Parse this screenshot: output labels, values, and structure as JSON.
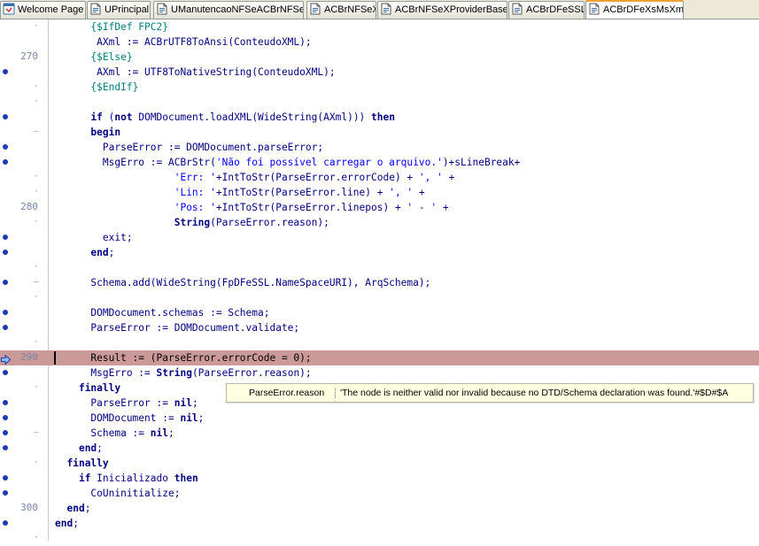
{
  "tabs": [
    {
      "label": "Welcome Page",
      "icon": "welcome-page-icon",
      "active": false
    },
    {
      "label": "UPrincipal",
      "icon": "unit-file-icon",
      "active": false
    },
    {
      "label": "UManutencaoNFSeACBrNFSeX",
      "icon": "unit-file-icon",
      "active": false
    },
    {
      "label": "ACBrNFSeX",
      "icon": "unit-file-icon",
      "active": false
    },
    {
      "label": "ACBrNFSeXProviderBase",
      "icon": "unit-file-icon",
      "active": false
    },
    {
      "label": "ACBrDFeSSL",
      "icon": "unit-file-icon",
      "active": false
    },
    {
      "label": "ACBrDFeXsMsXml",
      "icon": "unit-file-icon",
      "active": true
    }
  ],
  "editor": {
    "line_numbers": [
      "270",
      "280",
      "290",
      "300"
    ],
    "lines": [
      {
        "tokens": [
          [
            "      ",
            "p"
          ],
          [
            "{$IfDef FPC2}",
            "d"
          ]
        ],
        "gutter": "tick"
      },
      {
        "tokens": [
          [
            "       AXml := ACBrUTF8ToAnsi(ConteudoXML);",
            "p"
          ]
        ],
        "gutter": "none"
      },
      {
        "tokens": [
          [
            "      ",
            "p"
          ],
          [
            "{$Else}",
            "d"
          ]
        ],
        "gutter": "num",
        "num": 0
      },
      {
        "tokens": [
          [
            "       AXml := UTF8ToNativeString(ConteudoXML);",
            "p"
          ]
        ],
        "gutter": "dot"
      },
      {
        "tokens": [
          [
            "      ",
            "p"
          ],
          [
            "{$EndIf}",
            "d"
          ]
        ],
        "gutter": "tick"
      },
      {
        "tokens": [],
        "gutter": "tick"
      },
      {
        "tokens": [
          [
            "      ",
            "p"
          ],
          [
            "if",
            "k"
          ],
          [
            " (",
            "p"
          ],
          [
            "not",
            "k"
          ],
          [
            " DOMDocument.loadXML(WideString(AXml))) ",
            "p"
          ],
          [
            "then",
            "k"
          ]
        ],
        "gutter": "dot"
      },
      {
        "tokens": [
          [
            "      ",
            "p"
          ],
          [
            "begin",
            "k"
          ]
        ],
        "gutter": "dash"
      },
      {
        "tokens": [
          [
            "        ParseError := DOMDocument.parseError;",
            "p"
          ]
        ],
        "gutter": "dot"
      },
      {
        "tokens": [
          [
            "        MsgErro := ACBrStr(",
            "p"
          ],
          [
            "'Não foi possível carregar o arquivo.'",
            "s"
          ],
          [
            ")+sLineBreak+",
            "p"
          ]
        ],
        "gutter": "dot"
      },
      {
        "tokens": [
          [
            "                    ",
            "p"
          ],
          [
            "'Err: '",
            "s"
          ],
          [
            "+IntToStr(ParseError.errorCode) + ",
            "p"
          ],
          [
            "', '",
            "s"
          ],
          [
            " +",
            "p"
          ]
        ],
        "gutter": "tick"
      },
      {
        "tokens": [
          [
            "                    ",
            "p"
          ],
          [
            "'Lin: '",
            "s"
          ],
          [
            "+IntToStr(ParseError.line) + ",
            "p"
          ],
          [
            "', '",
            "s"
          ],
          [
            " +",
            "p"
          ]
        ],
        "gutter": "tick"
      },
      {
        "tokens": [
          [
            "                    ",
            "p"
          ],
          [
            "'Pos: '",
            "s"
          ],
          [
            "+IntToStr(ParseError.linepos) + ",
            "p"
          ],
          [
            "' - '",
            "s"
          ],
          [
            " +",
            "p"
          ]
        ],
        "gutter": "num",
        "num": 1
      },
      {
        "tokens": [
          [
            "                    ",
            "p"
          ],
          [
            "String",
            "k"
          ],
          [
            "(ParseError.reason);",
            "p"
          ]
        ],
        "gutter": "tick"
      },
      {
        "tokens": [
          [
            "        exit;",
            "p"
          ]
        ],
        "gutter": "dot"
      },
      {
        "tokens": [
          [
            "      ",
            "p"
          ],
          [
            "end",
            "k"
          ],
          [
            ";",
            "p"
          ]
        ],
        "gutter": "dot"
      },
      {
        "tokens": [],
        "gutter": "tick"
      },
      {
        "tokens": [
          [
            "      Schema.add(WideString(FpDFeSSL.NameSpaceURI), ArqSchema);",
            "p"
          ]
        ],
        "gutter": "dot-dash"
      },
      {
        "tokens": [],
        "gutter": "tick"
      },
      {
        "tokens": [
          [
            "      DOMDocument.schemas := Schema;",
            "p"
          ]
        ],
        "gutter": "dot"
      },
      {
        "tokens": [
          [
            "      ParseError := DOMDocument.validate;",
            "p"
          ]
        ],
        "gutter": "dot"
      },
      {
        "tokens": [],
        "gutter": "tick"
      },
      {
        "tokens": [
          [
            "      Result := (ParseError.errorCode = 0);",
            "p"
          ]
        ],
        "gutter": "arrow-num",
        "num": 2,
        "exec": true
      },
      {
        "tokens": [
          [
            "      MsgErro := ",
            "p"
          ],
          [
            "String",
            "k"
          ],
          [
            "(ParseError.reason);",
            "p"
          ]
        ],
        "gutter": "dot"
      },
      {
        "tokens": [
          [
            "    ",
            "p"
          ],
          [
            "finally",
            "k"
          ]
        ],
        "gutter": "tick"
      },
      {
        "tokens": [
          [
            "      ParseError := ",
            "p"
          ],
          [
            "nil",
            "k"
          ],
          [
            ";",
            "p"
          ]
        ],
        "gutter": "dot"
      },
      {
        "tokens": [
          [
            "      DOMDocument := ",
            "p"
          ],
          [
            "nil",
            "k"
          ],
          [
            ";",
            "p"
          ]
        ],
        "gutter": "dot"
      },
      {
        "tokens": [
          [
            "      Schema := ",
            "p"
          ],
          [
            "nil",
            "k"
          ],
          [
            ";",
            "p"
          ]
        ],
        "gutter": "dot-dash"
      },
      {
        "tokens": [
          [
            "    ",
            "p"
          ],
          [
            "end",
            "k"
          ],
          [
            ";",
            "p"
          ]
        ],
        "gutter": "dot"
      },
      {
        "tokens": [
          [
            "  ",
            "p"
          ],
          [
            "finally",
            "k"
          ]
        ],
        "gutter": "tick"
      },
      {
        "tokens": [
          [
            "    ",
            "p"
          ],
          [
            "if",
            "k"
          ],
          [
            " Inicializado ",
            "p"
          ],
          [
            "then",
            "k"
          ]
        ],
        "gutter": "dot"
      },
      {
        "tokens": [
          [
            "      CoUninitialize;",
            "p"
          ]
        ],
        "gutter": "dot"
      },
      {
        "tokens": [
          [
            "  ",
            "p"
          ],
          [
            "end",
            "k"
          ],
          [
            ";",
            "p"
          ]
        ],
        "gutter": "num",
        "num": 3
      },
      {
        "tokens": [
          [
            "end",
            "k"
          ],
          [
            ";",
            "p"
          ]
        ],
        "gutter": "dot"
      },
      {
        "tokens": [],
        "gutter": "tick"
      }
    ]
  },
  "tooltip": {
    "name": "ParseError.reason",
    "value": "'The node is neither valid nor invalid because no DTD/Schema declaration was found.'#$D#$A"
  },
  "colors": {
    "keyword": "#000080",
    "string": "#0000ff",
    "directive": "#008080",
    "execution_line": "#cc9999",
    "breakpoint_dot": "#1c3ab8",
    "active_tab_accent": "#f0a030"
  }
}
